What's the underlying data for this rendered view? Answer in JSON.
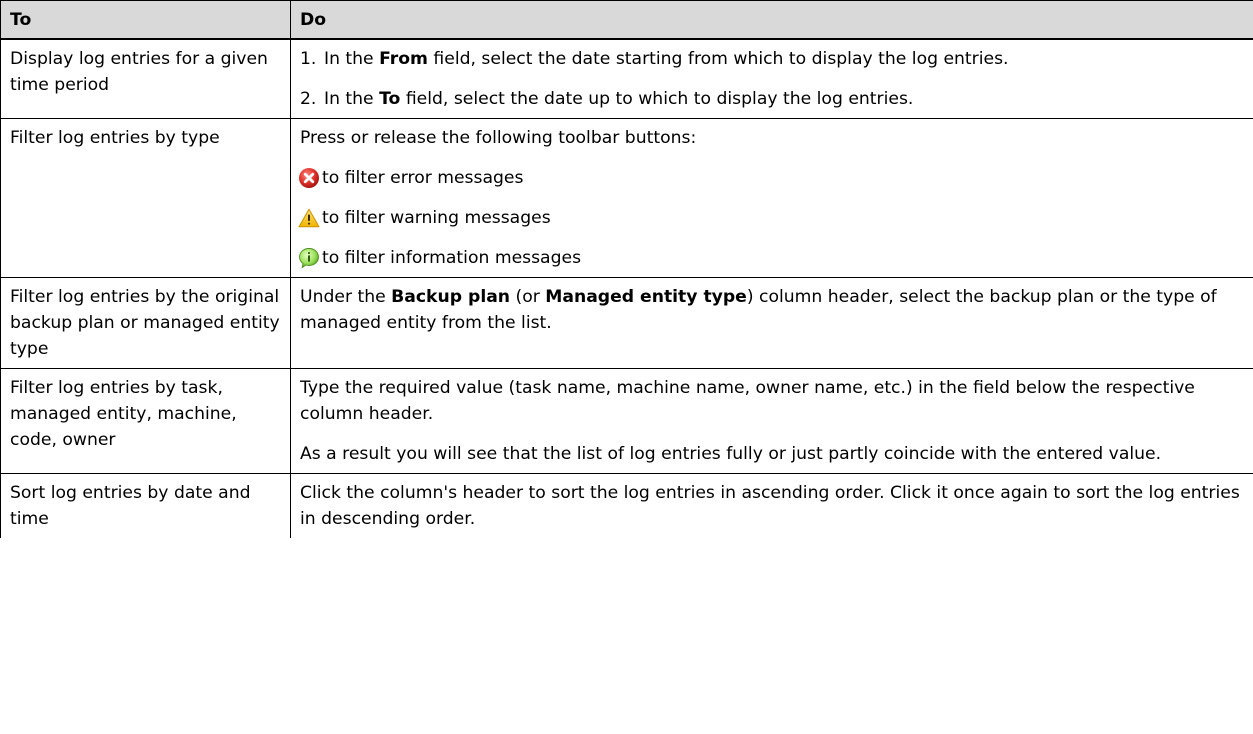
{
  "table": {
    "headers": {
      "to": "To",
      "do": "Do"
    },
    "rows": [
      {
        "to": "Display log entries for a given time period",
        "do": {
          "steps": [
            {
              "num": "1.",
              "pre": "In the ",
              "bold": "From",
              "post": " field, select the date starting from which to display the log entries."
            },
            {
              "num": "2.",
              "pre": "In the ",
              "bold": "To",
              "post": " field, select the date up to which to display the log entries."
            }
          ]
        }
      },
      {
        "to": "Filter log entries by type",
        "do": {
          "intro": "Press or release the following toolbar buttons:",
          "items": [
            {
              "icon": "error-icon",
              "text": "to filter error messages"
            },
            {
              "icon": "warning-icon",
              "text": "to filter warning messages"
            },
            {
              "icon": "information-icon",
              "text": "to filter information messages"
            }
          ]
        }
      },
      {
        "to": "Filter log entries by the original backup plan or managed entity type",
        "do": {
          "t1": "Under the ",
          "b1": "Backup plan",
          "t2": " (or ",
          "b2": "Managed entity type",
          "t3": ") column header, select the backup plan or the type of managed entity from the list."
        }
      },
      {
        "to": "Filter log entries by task, managed entity, machine, code, owner",
        "do": {
          "p1": "Type the required value (task name, machine name, owner name, etc.) in the field below the respective column header.",
          "p2": "As a result you will see that the list of log entries fully or just partly coincide with the entered value."
        }
      },
      {
        "to": "Sort log entries by date and time",
        "do": {
          "p1": "Click the column's header to sort the log entries in ascending order. Click it once again to sort the log entries in descending order."
        }
      }
    ]
  },
  "colors": {
    "header_bg": "#d9d9d9",
    "border": "#000000",
    "error": "#d9302a",
    "warning": "#f2c41c",
    "information": "#8ed94a"
  }
}
